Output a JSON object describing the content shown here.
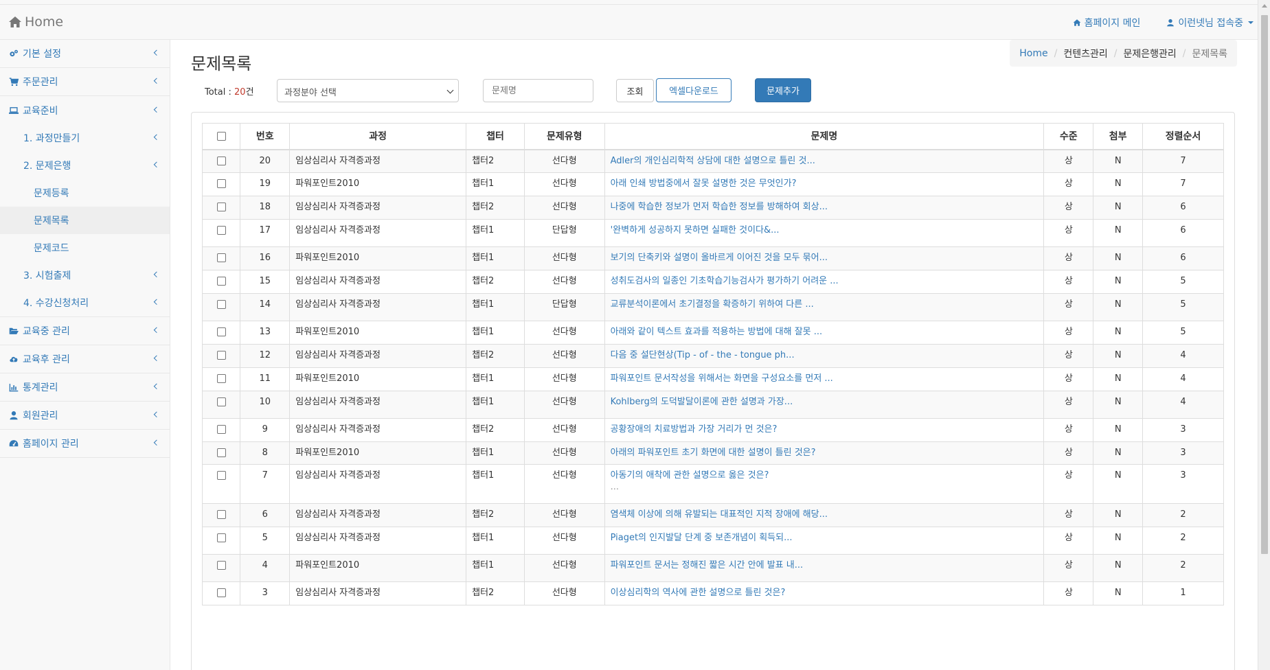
{
  "navbar": {
    "brand": "Home",
    "home_link": "홈페이지 메인",
    "user_link": "이런넷님 접속중"
  },
  "sidebar": {
    "items": [
      {
        "label": "기본 설정",
        "icon": "gears-icon"
      },
      {
        "label": "주문관리",
        "icon": "cart-icon"
      },
      {
        "label": "교육준비",
        "icon": "laptop-icon"
      }
    ],
    "sub": [
      {
        "label": "1. 과정만들기"
      },
      {
        "label": "2. 문제은행"
      }
    ],
    "sub3": [
      {
        "label": "문제등록"
      },
      {
        "label": "문제목록"
      },
      {
        "label": "문제코드"
      }
    ],
    "sub_after": [
      {
        "label": "3. 시험출제"
      },
      {
        "label": "4. 수강신청처리"
      }
    ],
    "items_after": [
      {
        "label": "교육중 관리",
        "icon": "folder-open-icon"
      },
      {
        "label": "교육후 관리",
        "icon": "cloud-upload-icon"
      },
      {
        "label": "통계관리",
        "icon": "bar-chart-icon"
      },
      {
        "label": "회원관리",
        "icon": "user-icon"
      },
      {
        "label": "홈페이지 관리",
        "icon": "dashboard-icon"
      }
    ]
  },
  "page": {
    "title": "문제목록",
    "breadcrumb": [
      "Home",
      "컨텐츠관리",
      "문제은행관리",
      "문제목록"
    ]
  },
  "toolbar": {
    "total_label": "Total : ",
    "total_count": "20",
    "total_unit": "건",
    "category_select": "과정분야 선택",
    "search_placeholder": "문제명",
    "search_button": "조회",
    "excel_button": "엑셀다운로드",
    "add_button": "문제추가"
  },
  "table": {
    "headers": [
      "번호",
      "과정",
      "챕터",
      "문제유형",
      "문제명",
      "수준",
      "첨부",
      "정렬순서"
    ],
    "rows": [
      {
        "no": "20",
        "course": "임상심리사 자격증과정",
        "chapter": "챕터2",
        "type": "선다형",
        "title": "Adler의 개인심리학적 상담에 대한 설명으로 틀린 것...",
        "level": "상",
        "attach": "N",
        "order": "7"
      },
      {
        "no": "19",
        "course": "파워포인트2010",
        "chapter": "챕터1",
        "type": "선다형",
        "title": "아래 인쇄 방법중에서 잘못 설명한 것은 무엇인가?",
        "level": "상",
        "attach": "N",
        "order": "7"
      },
      {
        "no": "18",
        "course": "임상심리사 자격증과정",
        "chapter": "챕터2",
        "type": "선다형",
        "title": "나중에 학습한 정보가 먼저 학습한 정보를 방해하여 회상...",
        "level": "상",
        "attach": "N",
        "order": "6"
      },
      {
        "no": "17",
        "course": "임상심리사 자격증과정",
        "chapter": "챕터1",
        "type": "단답형",
        "title": "'완벽하게 성공하지 못하면 실패한 것이다&...",
        "level": "상",
        "attach": "N",
        "order": "6"
      },
      {
        "no": "16",
        "course": "파워포인트2010",
        "chapter": "챕터1",
        "type": "선다형",
        "title": "보기의 단축키와 설명이 올바르게 이어진 것을 모두 묶어...",
        "level": "상",
        "attach": "N",
        "order": "6"
      },
      {
        "no": "15",
        "course": "임상심리사 자격증과정",
        "chapter": "챕터2",
        "type": "선다형",
        "title": "성취도검사의 일종인 기초학습기능검사가 평가하기 어려운 ...",
        "level": "상",
        "attach": "N",
        "order": "5"
      },
      {
        "no": "14",
        "course": "임상심리사 자격증과정",
        "chapter": "챕터1",
        "type": "단답형",
        "title": "교류분석이론에서 초기결정을 확증하기 위하여 다른 ...",
        "level": "상",
        "attach": "N",
        "order": "5"
      },
      {
        "no": "13",
        "course": "파워포인트2010",
        "chapter": "챕터1",
        "type": "선다형",
        "title": "아래와 같이 텍스트 효과를 적용하는 방법에 대해 잘못 ...",
        "level": "상",
        "attach": "N",
        "order": "5"
      },
      {
        "no": "12",
        "course": "임상심리사 자격증과정",
        "chapter": "챕터2",
        "type": "선다형",
        "title": "다음 중 설단현상(Tip - of - the - tongue ph...",
        "level": "상",
        "attach": "N",
        "order": "4"
      },
      {
        "no": "11",
        "course": "파워포인트2010",
        "chapter": "챕터1",
        "type": "선다형",
        "title": "파워포인트 문서작성을 위해서는 화면을 구성요소를 먼저 ...",
        "level": "상",
        "attach": "N",
        "order": "4"
      },
      {
        "no": "10",
        "course": "임상심리사 자격증과정",
        "chapter": "챕터1",
        "type": "선다형",
        "title": "Kohlberg의 도덕발달이론에 관한 설명과 가장...",
        "level": "상",
        "attach": "N",
        "order": "4"
      },
      {
        "no": "9",
        "course": "임상심리사 자격증과정",
        "chapter": "챕터2",
        "type": "선다형",
        "title": "공황장애의 치료방법과 가장 거리가 먼 것은?",
        "level": "상",
        "attach": "N",
        "order": "3"
      },
      {
        "no": "8",
        "course": "파워포인트2010",
        "chapter": "챕터1",
        "type": "선다형",
        "title": "아래의 파워포인트 초기 화면에 대한 설명이 틀린 것은?",
        "level": "상",
        "attach": "N",
        "order": "3"
      },
      {
        "no": "7",
        "course": "임상심리사 자격증과정",
        "chapter": "챕터1",
        "type": "선다형",
        "title": "아동기의 애착에 관한 설명으로 옳은 것은?",
        "extra": "...",
        "level": "상",
        "attach": "N",
        "order": "3"
      },
      {
        "no": "6",
        "course": "임상심리사 자격증과정",
        "chapter": "챕터2",
        "type": "선다형",
        "title": "염색체 이상에 의해 유발되는 대표적인 지적 장애에 해당...",
        "level": "상",
        "attach": "N",
        "order": "2"
      },
      {
        "no": "5",
        "course": "임상심리사 자격증과정",
        "chapter": "챕터1",
        "type": "선다형",
        "title": "Piaget의 인지발달 단계 중 보존개념이 획득되...",
        "level": "상",
        "attach": "N",
        "order": "2"
      },
      {
        "no": "4",
        "course": "파워포인트2010",
        "chapter": "챕터1",
        "type": "선다형",
        "title": "파워포인트 문서는 정해진 짧은 시간 안에 발표 내...",
        "level": "상",
        "attach": "N",
        "order": "2"
      },
      {
        "no": "3",
        "course": "임상심리사 자격증과정",
        "chapter": "챕터2",
        "type": "선다형",
        "title": "이상심리학의 역사에 관한 설명으로 틀린 것은?",
        "level": "상",
        "attach": "N",
        "order": "1"
      }
    ],
    "row_heights": null
  }
}
